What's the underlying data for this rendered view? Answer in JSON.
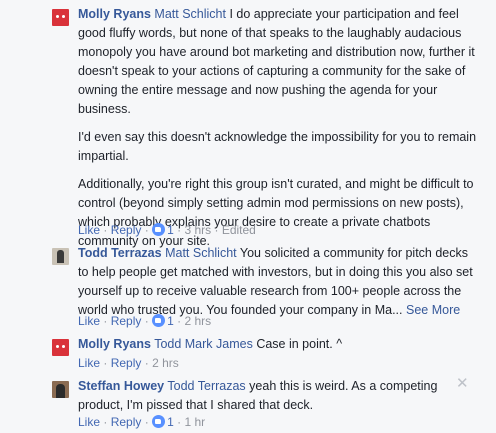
{
  "comments": [
    {
      "author": "Molly Ryans",
      "mention": "Matt Schlicht",
      "paragraphs": [
        " I do appreciate your participation and feel good fluffy words, but none of that speaks to the laughably audacious monopoly you have around bot marketing and distribution now, further it doesn't speak to your actions of capturing a community for the sake of owning the entire message and now pushing the agenda for your business.",
        "I'd even say this doesn't acknowledge the impossibility for you to remain impartial.",
        "Additionally, you're right this group isn't curated, and might be difficult to control (beyond simply setting admin mod permissions on new posts), which probably explains your desire to create a private chatbots community on your site."
      ],
      "actions": {
        "like": "Like",
        "reply": "Reply",
        "likes": "1",
        "time": "3 hrs",
        "edited": "Edited"
      }
    },
    {
      "author": "Todd Terrazas",
      "mention": "Matt Schlicht",
      "text": " You solicited a community for pitch decks to help people get matched with investors, but in doing this you also set yourself up to receive valuable research from 100+ people across the world who trusted you. You founded your company in Ma...",
      "see_more": "See More",
      "actions": {
        "like": "Like",
        "reply": "Reply",
        "likes": "1",
        "time": "2 hrs"
      }
    },
    {
      "author": "Molly Ryans",
      "mention": "Todd Mark James",
      "text": " Case in point. ^",
      "actions": {
        "like": "Like",
        "reply": "Reply",
        "time": "2 hrs"
      }
    },
    {
      "author": "Steffan Howey",
      "mention": "Todd Terrazas",
      "text": " yeah this is weird. As a competing product, I'm pissed that I shared that deck.",
      "actions": {
        "like": "Like",
        "reply": "Reply",
        "likes": "1",
        "time": "1 hr"
      }
    }
  ],
  "icons": {
    "close": "close-icon",
    "like_badge": "thumbs-up-icon"
  }
}
